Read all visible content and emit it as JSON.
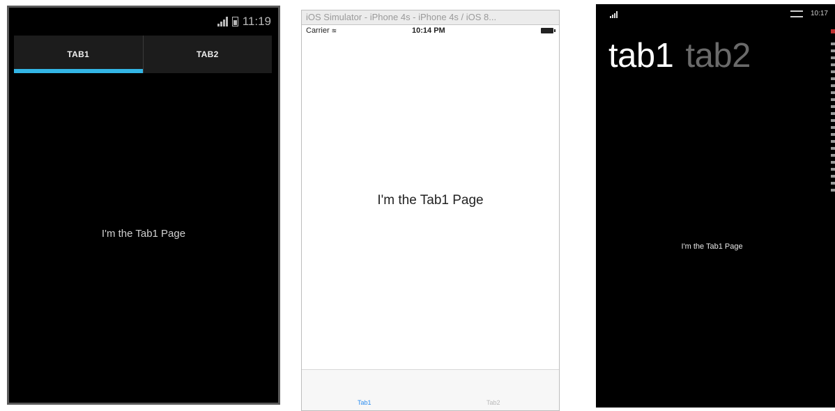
{
  "android": {
    "status": {
      "time": "11:19",
      "signal_icon": "signal-icon",
      "battery_icon": "battery-icon"
    },
    "tabs": [
      {
        "label": "TAB1",
        "selected": true
      },
      {
        "label": "TAB2",
        "selected": false
      }
    ],
    "content_text": "I'm the Tab1 Page",
    "accent_color": "#33b5e5"
  },
  "ios": {
    "window_title": "iOS Simulator - iPhone 4s - iPhone 4s / iOS 8...",
    "status": {
      "carrier": "Carrier",
      "time": "10:14 PM",
      "wifi_icon": "wifi-icon",
      "battery_icon": "battery-icon"
    },
    "content_text": "I'm the Tab1 Page",
    "tabs": [
      {
        "label": "Tab1",
        "selected": true
      },
      {
        "label": "Tab2",
        "selected": false
      }
    ],
    "accent_color": "#2a8cf0"
  },
  "windows_phone": {
    "status": {
      "time": "10:17",
      "signal_icon": "signal-icon",
      "wifi_icon": "wifi-icon"
    },
    "pivot_headers": [
      {
        "label": "tab1",
        "selected": true
      },
      {
        "label": "tab2",
        "selected": false
      }
    ],
    "content_text": "I'm the Tab1 Page"
  }
}
